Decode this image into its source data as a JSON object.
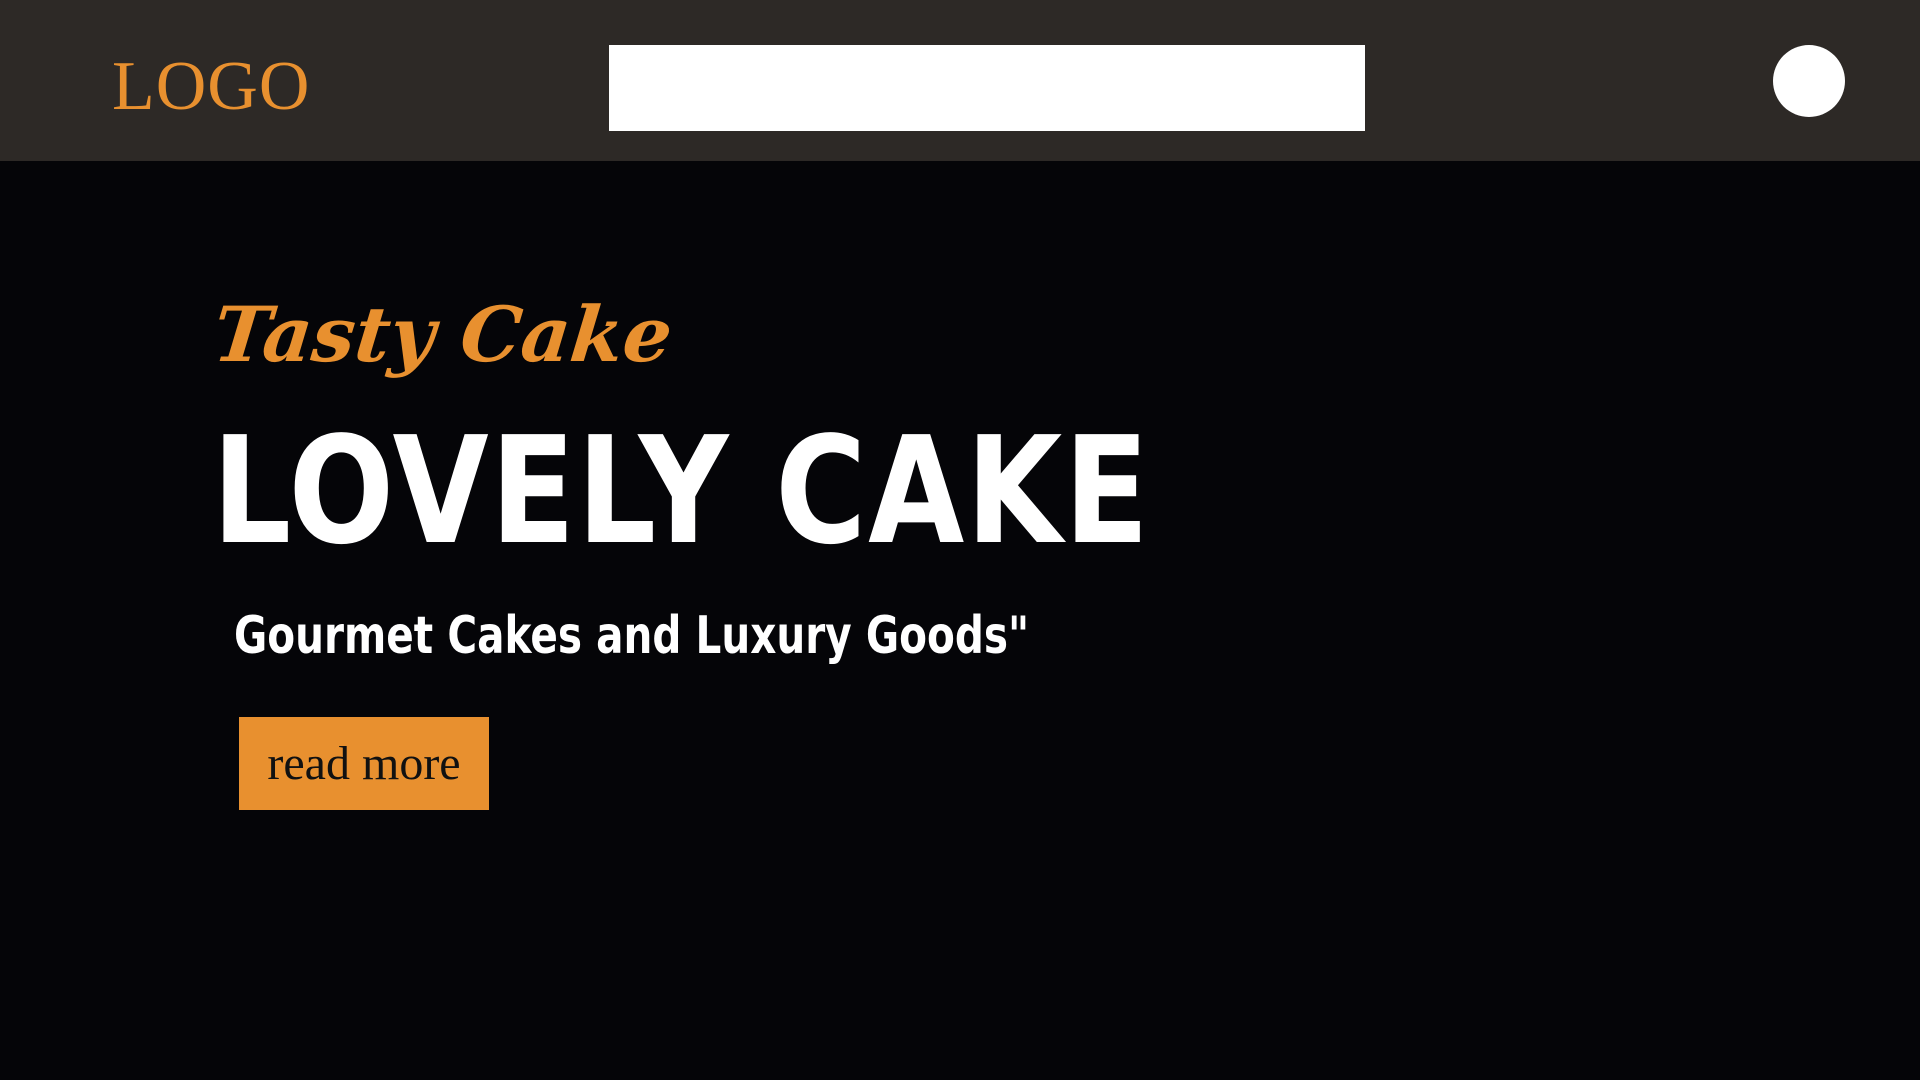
{
  "header": {
    "logo_text": "LOGO",
    "search": {
      "value": "",
      "placeholder": ""
    },
    "avatar_icon": "user-avatar-circle"
  },
  "hero": {
    "subtitle": "Tasty Cake",
    "title": "LOVELY CAKE",
    "tagline": "Gourmet Cakes and Luxury Goods\"",
    "cta_label": "read more"
  },
  "colors": {
    "header_background": "#2d2926",
    "page_background": "#050508",
    "accent": "#e8902f",
    "text_primary": "#ffffff",
    "button_text": "#111111"
  }
}
